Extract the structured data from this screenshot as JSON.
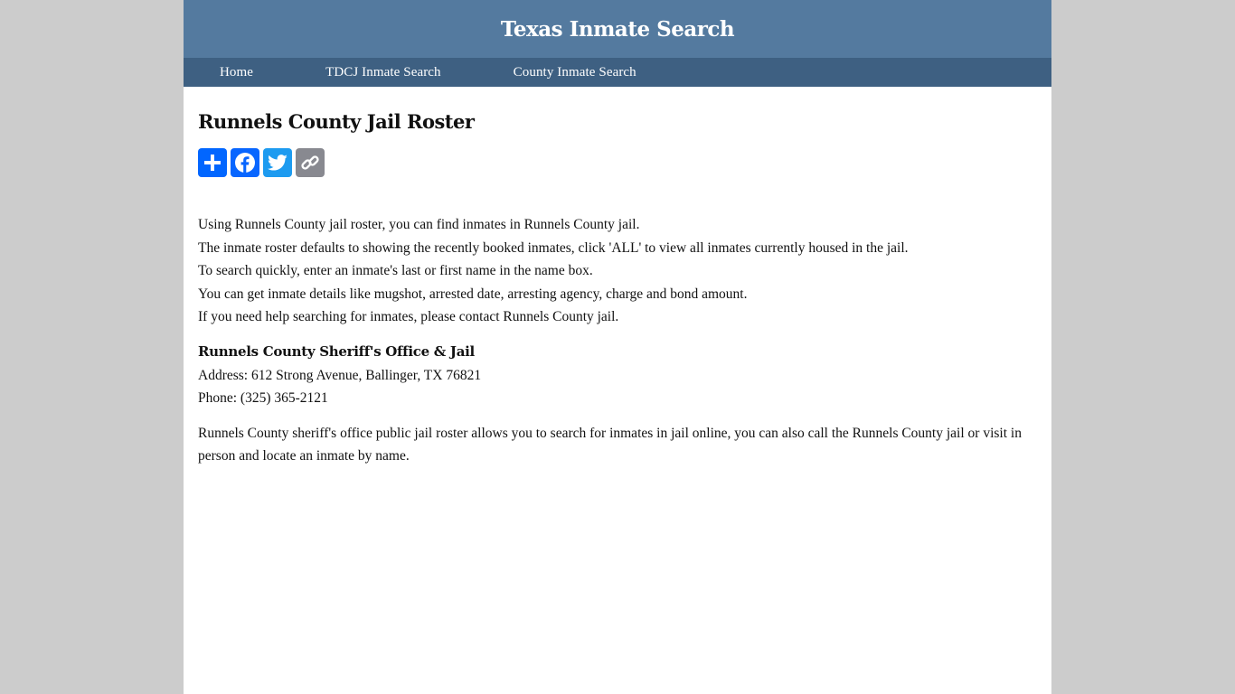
{
  "header": {
    "title": "Texas Inmate Search"
  },
  "nav": {
    "items": [
      {
        "label": "Home"
      },
      {
        "label": "TDCJ Inmate Search"
      },
      {
        "label": "County Inmate Search"
      }
    ]
  },
  "main": {
    "title": "Runnels County Jail Roster",
    "share": [
      {
        "icon": "plus-share-icon",
        "color": "#0166ff"
      },
      {
        "icon": "facebook-icon",
        "color": "#0866ff"
      },
      {
        "icon": "twitter-icon",
        "color": "#1d9bf0"
      },
      {
        "icon": "copy-link-icon",
        "color": "#888990"
      }
    ],
    "intro": [
      "Using Runnels County jail roster, you can find inmates in Runnels County jail.",
      "The inmate roster defaults to showing the recently booked inmates, click 'ALL' to view all inmates currently housed in the jail.",
      "To search quickly, enter an inmate's last or first name in the name box.",
      "You can get inmate details like mugshot, arrested date, arresting agency, charge and bond amount.",
      "If you need help searching for inmates, please contact Runnels County jail."
    ],
    "office": {
      "name": "Runnels County Sheriff's Office & Jail",
      "address": "Address: 612 Strong Avenue, Ballinger, TX 76821",
      "phone": "Phone: (325) 365-2121"
    },
    "outro": "Runnels County sheriff's office public jail roster allows you to search for inmates in jail online, you can also call the Runnels County jail or visit in person and locate an inmate by name."
  }
}
